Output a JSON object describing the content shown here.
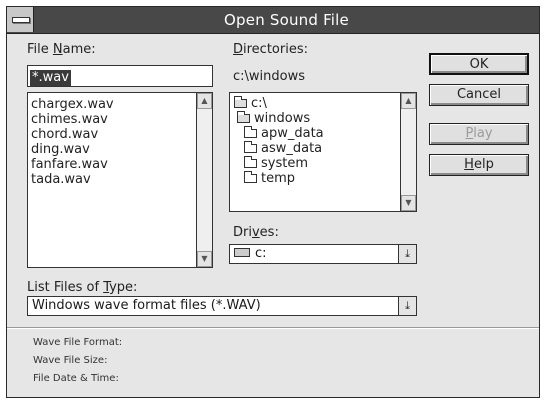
{
  "window": {
    "title": "Open Sound File"
  },
  "file_name": {
    "label_pre": "File ",
    "label_key": "N",
    "label_post": "ame:",
    "value": "*.wav",
    "files": [
      "chargex.wav",
      "chimes.wav",
      "chord.wav",
      "ding.wav",
      "fanfare.wav",
      "tada.wav"
    ]
  },
  "directories": {
    "label_pre": "",
    "label_key": "D",
    "label_post": "irectories:",
    "current_path": "c:\\windows",
    "tree": [
      {
        "name": "c:\\",
        "icon": "open-folder-icon"
      },
      {
        "name": "windows",
        "icon": "open-folder-icon"
      },
      {
        "name": "apw_data",
        "icon": "folder-icon"
      },
      {
        "name": "asw_data",
        "icon": "folder-icon"
      },
      {
        "name": "system",
        "icon": "folder-icon"
      },
      {
        "name": "temp",
        "icon": "folder-icon"
      }
    ]
  },
  "drives": {
    "label_pre": "Dri",
    "label_key": "v",
    "label_post": "es:",
    "selected": "c:",
    "icon": "drive-icon"
  },
  "file_type": {
    "label_pre": "List Files of ",
    "label_key": "T",
    "label_post": "ype:",
    "selected": "Windows wave format files (*.WAV)"
  },
  "buttons": {
    "ok": "OK",
    "cancel": "Cancel",
    "play": {
      "pre": "",
      "key": "P",
      "post": "lay",
      "enabled": false
    },
    "help": {
      "pre": "",
      "key": "H",
      "post": "elp"
    }
  },
  "info": {
    "format_label": "Wave File Format:",
    "size_label": "Wave File Size:",
    "date_label": "File Date & Time:"
  },
  "icons": {
    "scroll_up": "▲",
    "scroll_down": "▼",
    "dropdown": "⤓"
  }
}
